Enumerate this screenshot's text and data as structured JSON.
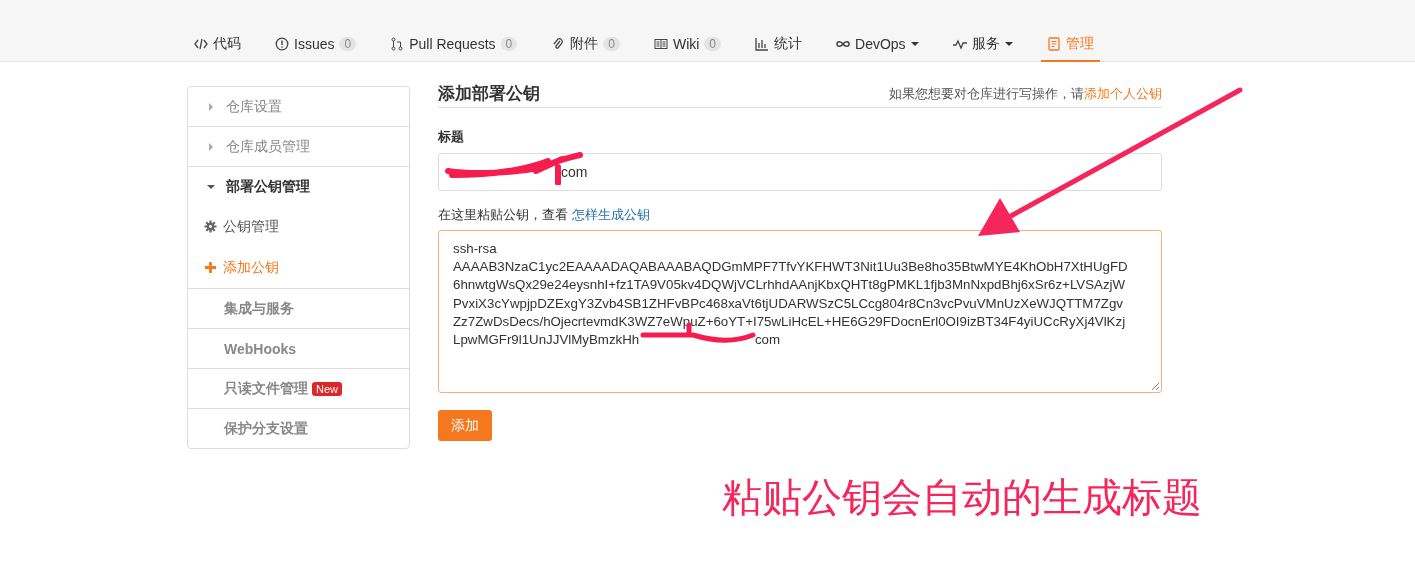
{
  "tabs": [
    {
      "label": "代码",
      "kind": "code",
      "selected": false
    },
    {
      "label": "Issues",
      "kind": "issue",
      "count": "0",
      "selected": false
    },
    {
      "label": "Pull Requests",
      "kind": "pr",
      "count": "0",
      "selected": false
    },
    {
      "label": "附件",
      "kind": "clip",
      "count": "0",
      "selected": false
    },
    {
      "label": "Wiki",
      "kind": "book",
      "count": "0",
      "selected": false
    },
    {
      "label": "统计",
      "kind": "chart",
      "selected": false
    },
    {
      "label": "DevOps",
      "kind": "infinity",
      "caret": true,
      "selected": false
    },
    {
      "label": "服务",
      "kind": "pulse",
      "caret": true,
      "selected": false
    },
    {
      "label": "管理",
      "kind": "doc",
      "selected": true
    }
  ],
  "sidebar": {
    "items": [
      {
        "label": "仓库设置",
        "expanded": false
      },
      {
        "label": "仓库成员管理",
        "expanded": false
      },
      {
        "label": "部署公钥管理",
        "expanded": true,
        "children": [
          {
            "label": "公钥管理",
            "kind": "gear",
            "selected": false
          },
          {
            "label": "添加公钥",
            "kind": "plus",
            "selected": true
          }
        ]
      },
      {
        "label": "集成与服务"
      },
      {
        "label": "WebHooks"
      },
      {
        "label": "只读文件管理",
        "badge": "New"
      },
      {
        "label": "保护分支设置"
      }
    ]
  },
  "form": {
    "heading": "添加部署公钥",
    "hint": "如果您想要对仓库进行写操作，请",
    "hint_link": "添加个人公钥",
    "title_label": "标题",
    "title_value": "com",
    "key_label": "在这里粘贴公钥，查看",
    "key_link": "怎样生成公钥",
    "key_lines": [
      "ssh-rsa",
      "AAAAB3NzaC1yc2EAAAADAQABAAABAQDGmMPF7TfvYKFHWT3Nit1Uu3Be8ho35BtwMYE4KhObH7XtHUgFD",
      "6hnwtgWsQx29e24eysnhI+fz1TA9V05kv4DQWjVCLrhhdAAnjKbxQHTt8gPMKL1fjb3MnNxpdBhj6xSr6z+LVSAzjW",
      "PvxiX3cYwpjpDZExgY3Zvb4SB1ZHFvBPc468xaVt6tjUDARWSzC5LCcg804r8Cn3vcPvuVMnUzXeWJQTTM7Zgv",
      "Zz7ZwDsDecs/hOjecrtevmdK3WZ7eWpuZ+6oYT+I75wLiHcEL+HE6G29FDocnErl0OI9izBT34F4yiUCcRyXj4VlKzj"
    ],
    "key_last_start": "LpwMGFr9l1UnJJVlMyBmzkHh",
    "key_last_end": "com",
    "submit": "添加"
  },
  "annotation": {
    "text": "粘贴公钥会自动的生成标题"
  }
}
